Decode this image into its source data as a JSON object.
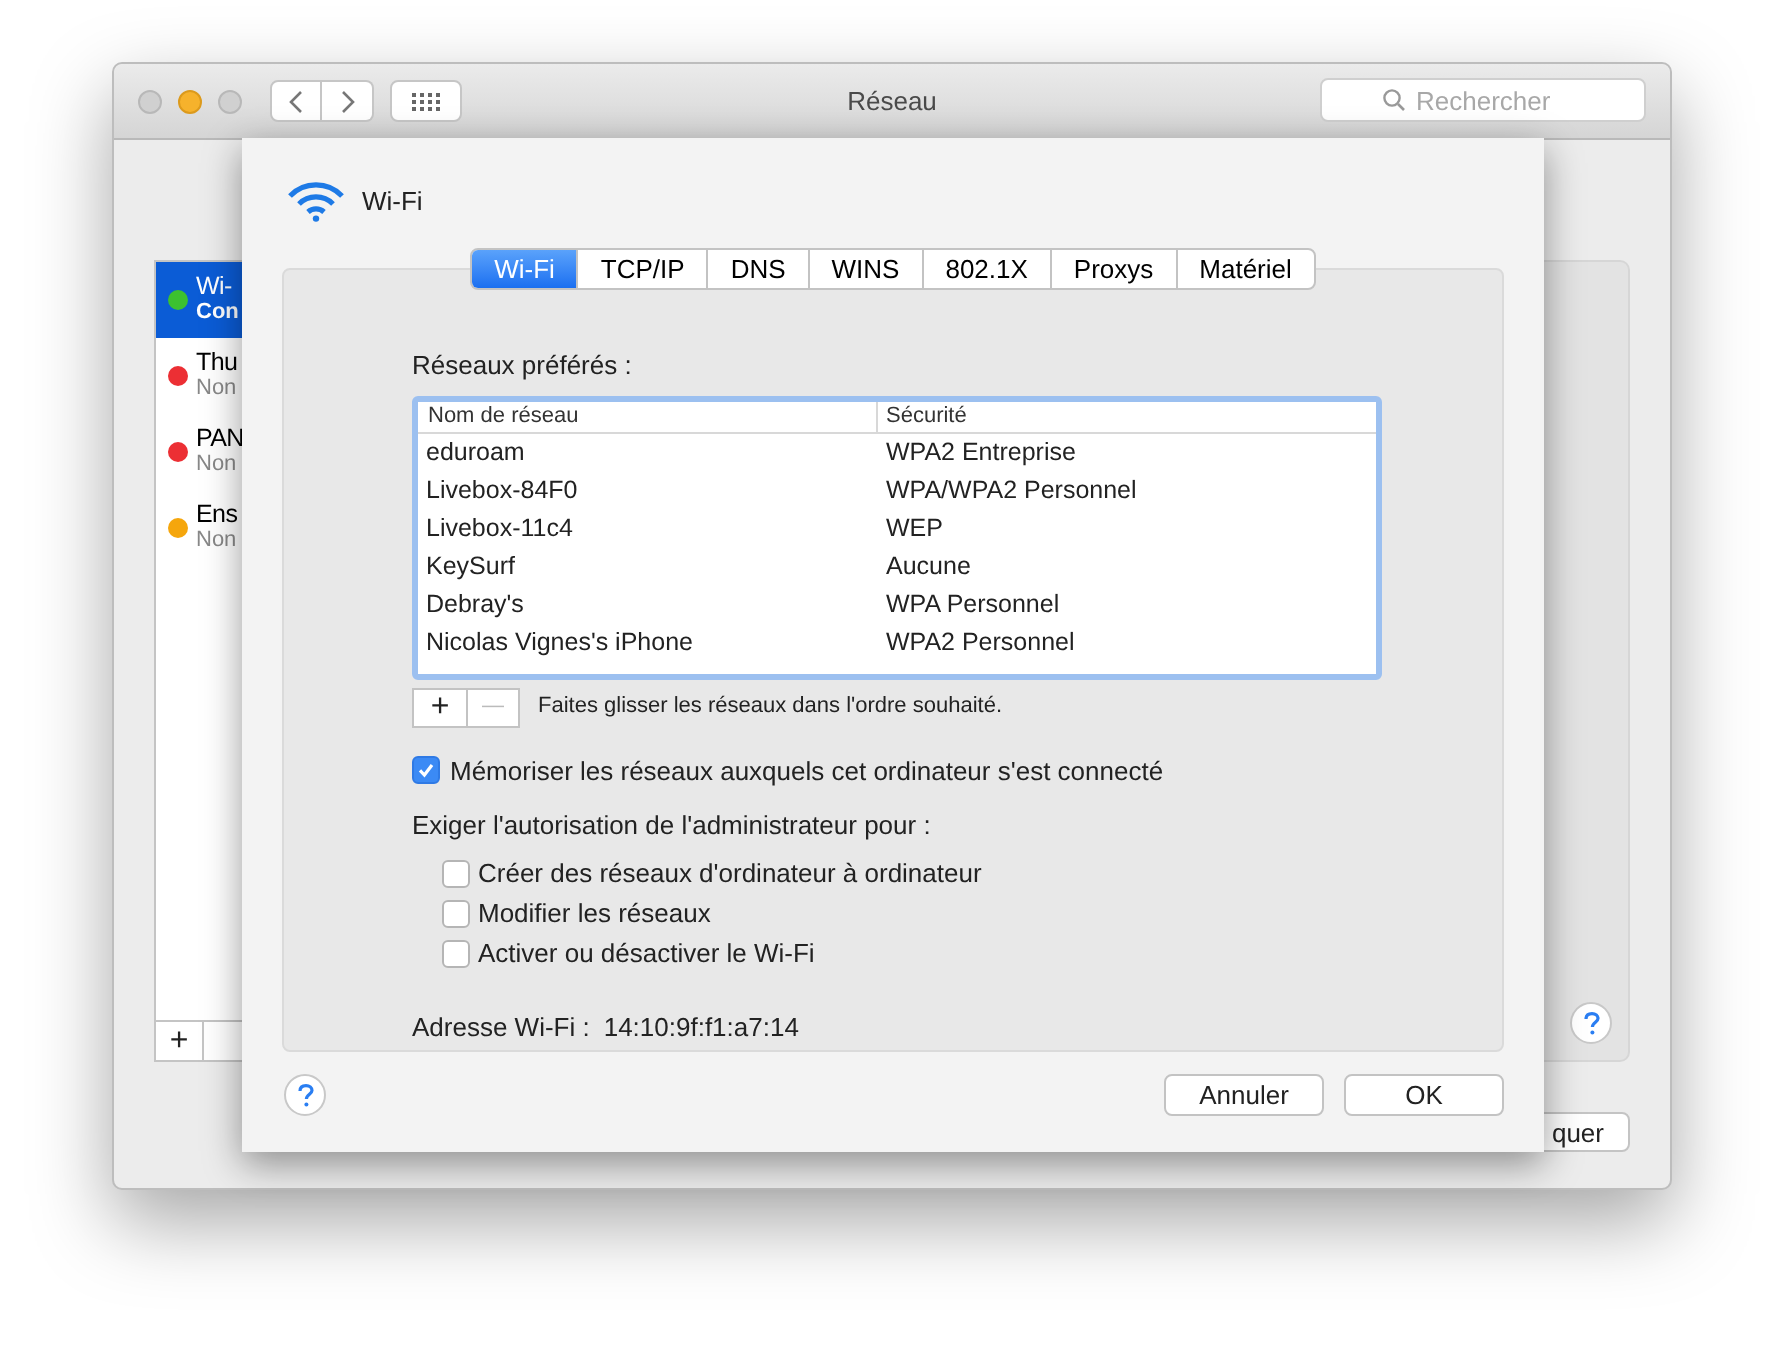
{
  "window": {
    "title": "Réseau",
    "search": {
      "placeholder": "Rechercher"
    }
  },
  "sidebar": {
    "items": [
      {
        "name": "Wi-",
        "status": "Con",
        "color": "#3cc12f",
        "selected": true
      },
      {
        "name": "Thu",
        "status": "Non",
        "color": "#ec2f34",
        "selected": false
      },
      {
        "name": "PAN",
        "status": "Non",
        "color": "#ec2f34",
        "selected": false
      },
      {
        "name": "Ens",
        "status": "Non",
        "color": "#f5a60c",
        "selected": false
      }
    ],
    "add_button": "+"
  },
  "background_button": "quer",
  "sheet": {
    "title": "Wi-Fi",
    "tabs": [
      {
        "label": "Wi-Fi",
        "selected": true
      },
      {
        "label": "TCP/IP",
        "selected": false
      },
      {
        "label": "DNS",
        "selected": false
      },
      {
        "label": "WINS",
        "selected": false
      },
      {
        "label": "802.1X",
        "selected": false
      },
      {
        "label": "Proxys",
        "selected": false
      },
      {
        "label": "Matériel",
        "selected": false
      }
    ],
    "preferred_networks": {
      "label": "Réseaux préférés :",
      "columns": [
        "Nom de réseau",
        "Sécurité"
      ],
      "rows": [
        {
          "name": "eduroam",
          "security": "WPA2 Entreprise"
        },
        {
          "name": "Livebox-84F0",
          "security": "WPA/WPA2 Personnel"
        },
        {
          "name": "Livebox-11c4",
          "security": "WEP"
        },
        {
          "name": "KeySurf",
          "security": "Aucune"
        },
        {
          "name": "Debray's",
          "security": "WPA Personnel"
        },
        {
          "name": "Nicolas Vignes's iPhone",
          "security": "WPA2 Personnel"
        }
      ],
      "add": "+",
      "remove": "—",
      "hint": "Faites glisser les réseaux dans l'ordre souhaité."
    },
    "remember": {
      "label": "Mémoriser les réseaux auxquels cet ordinateur s'est connecté",
      "checked": true
    },
    "admin": {
      "label": "Exiger l'autorisation de l'administrateur pour :",
      "options": [
        {
          "label": "Créer des réseaux d'ordinateur à ordinateur",
          "checked": false
        },
        {
          "label": "Modifier les réseaux",
          "checked": false
        },
        {
          "label": "Activer ou désactiver le Wi-Fi",
          "checked": false
        }
      ]
    },
    "address": {
      "label": "Adresse Wi-Fi :",
      "value": "14:10:9f:f1:a7:14"
    },
    "buttons": [
      "Annuler",
      "OK"
    ]
  }
}
